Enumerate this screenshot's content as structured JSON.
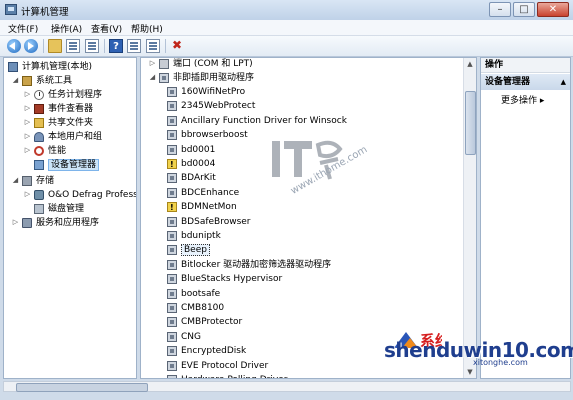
{
  "window": {
    "title": "计算机管理",
    "controls": {
      "minimize": "–",
      "maximize": "□",
      "close": "✕"
    }
  },
  "menu": [
    {
      "label": "文件(F)"
    },
    {
      "label": "操作(A)"
    },
    {
      "label": "查看(V)"
    },
    {
      "label": "帮助(H)"
    }
  ],
  "toolbar": {
    "icons": [
      "back-arrow-icon",
      "forward-arrow-icon",
      "up-folder-icon",
      "show-hide-tree-icon",
      "properties-icon",
      "help-icon",
      "console-icon",
      "scan-hardware-icon",
      "uninstall-icon"
    ]
  },
  "tree": {
    "root": "计算机管理(本地)",
    "system_tools": "系统工具",
    "task_scheduler": "任务计划程序",
    "event_viewer": "事件查看器",
    "shared_folders": "共享文件夹",
    "local_users": "本地用户和组",
    "performance": "性能",
    "device_manager": "设备管理器",
    "storage": "存储",
    "defrag": "O&O Defrag Professi",
    "disk_mgmt": "磁盘管理",
    "services": "服务和应用程序"
  },
  "devices": {
    "ports": "端口 (COM 和 LPT)",
    "non_pnp": "非即插即用驱动程序",
    "drivers": [
      {
        "label": "160WifiNetPro",
        "icon": "chip"
      },
      {
        "label": "2345WebProtect",
        "icon": "chip"
      },
      {
        "label": "Ancillary Function Driver for Winsock",
        "icon": "chip"
      },
      {
        "label": "bbrowserboost",
        "icon": "chip"
      },
      {
        "label": "bd0001",
        "icon": "chip"
      },
      {
        "label": "bd0004",
        "icon": "warn"
      },
      {
        "label": "BDArKit",
        "icon": "chip"
      },
      {
        "label": "BDCEnhance",
        "icon": "chip"
      },
      {
        "label": "BDMNetMon",
        "icon": "warn"
      },
      {
        "label": "BDSafeBrowser",
        "icon": "chip"
      },
      {
        "label": "bduniptk",
        "icon": "chip"
      },
      {
        "label": "Beep",
        "icon": "chip"
      },
      {
        "label": "Bitlocker 驱动器加密筛选器驱动程序",
        "icon": "chip"
      },
      {
        "label": "BlueStacks Hypervisor",
        "icon": "chip"
      },
      {
        "label": "bootsafe",
        "icon": "chip"
      },
      {
        "label": "CMB8100",
        "icon": "chip"
      },
      {
        "label": "CMBProtector",
        "icon": "chip"
      },
      {
        "label": "CNG",
        "icon": "chip"
      },
      {
        "label": "EncryptedDisk",
        "icon": "chip"
      },
      {
        "label": "EVE Protocol Driver",
        "icon": "chip"
      },
      {
        "label": "Hardware Polling Driver",
        "icon": "chip"
      }
    ],
    "selected": "Beep"
  },
  "actions": {
    "header": "操作",
    "section": "设备管理器",
    "more": "更多操作"
  },
  "watermarks": {
    "it": "IT之家",
    "ithome": "www.ithome.com",
    "brand": "shenduwin10.com",
    "brand_cn": "系统合",
    "brand_sub": "xitonghe.com"
  }
}
